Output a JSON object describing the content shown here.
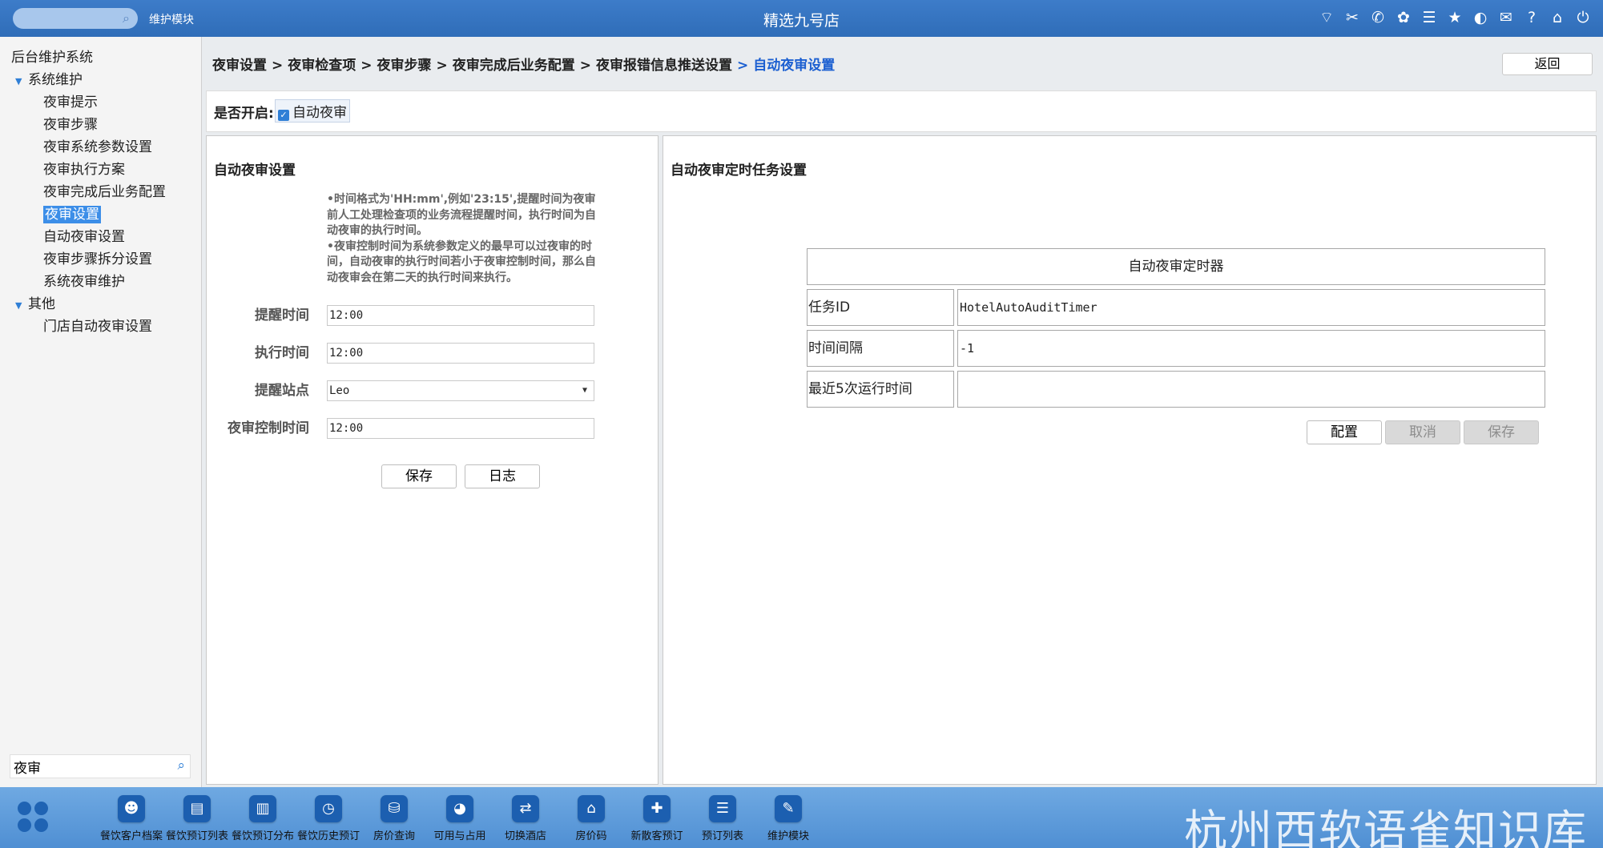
{
  "topbar": {
    "module": "维护模块",
    "title": "精选九号店",
    "icons": [
      "wifi-icon",
      "tools-icon",
      "phone-icon",
      "palette-icon",
      "menu-icon",
      "star-icon",
      "contrast-icon",
      "mail-icon",
      "help-icon",
      "home-icon",
      "power-icon"
    ]
  },
  "sidebar": {
    "root": "后台维护系统",
    "groups": [
      {
        "label": "系统维护",
        "items": [
          "夜审提示",
          "夜审步骤",
          "夜审系统参数设置",
          "夜审执行方案",
          "夜审完成后业务配置",
          "夜审设置",
          "自动夜审设置",
          "夜审步骤拆分设置",
          "系统夜审维护"
        ],
        "selected": "夜审设置"
      },
      {
        "label": "其他",
        "items": [
          "门店自动夜审设置"
        ]
      }
    ],
    "search_value": "夜审"
  },
  "breadcrumb": [
    "夜审设置",
    "夜审检查项",
    "夜审步骤",
    "夜审完成后业务配置",
    "夜审报错信息推送设置",
    "自动夜审设置"
  ],
  "back_label": "返回",
  "enable": {
    "label": "是否开启:",
    "checkbox_label": "自动夜审",
    "checked": true
  },
  "left_panel": {
    "title": "自动夜审设置",
    "notes": [
      "•时间格式为'HH:mm',例如'23:15',提醒时间为夜审前人工处理检查项的业务流程提醒时间，执行时间为自动夜审的执行时间。",
      "•夜审控制时间为系统参数定义的最早可以过夜审的时间，自动夜审的执行时间若小于夜审控制时间，那么自动夜审会在第二天的执行时间来执行。"
    ],
    "fields": [
      {
        "label": "提醒时间",
        "value": "12:00"
      },
      {
        "label": "执行时间",
        "value": "12:00"
      },
      {
        "label": "提醒站点",
        "value": "Leo",
        "dropdown": true
      },
      {
        "label": "夜审控制时间",
        "value": "12:00"
      }
    ],
    "save_label": "保存",
    "log_label": "日志"
  },
  "right_panel": {
    "title": "自动夜审定时任务设置",
    "timer_title": "自动夜审定时器",
    "rows": [
      {
        "key": "任务ID",
        "value": "HotelAutoAuditTimer"
      },
      {
        "key": "时间间隔",
        "value": "-1"
      },
      {
        "key": "最近5次运行时间",
        "value": ""
      }
    ],
    "config_label": "配置",
    "cancel_label": "取消",
    "save_label": "保存"
  },
  "bottombar": {
    "apps": [
      {
        "label": "餐饮客户档案",
        "icon": "user-icon",
        "glyph": "☻"
      },
      {
        "label": "餐饮预订列表",
        "icon": "clipboard-icon",
        "glyph": "▤"
      },
      {
        "label": "餐饮预订分布",
        "icon": "building-icon",
        "glyph": "▥"
      },
      {
        "label": "餐饮历史预订",
        "icon": "clock-icon",
        "glyph": "◷"
      },
      {
        "label": "房价查询",
        "icon": "database-icon",
        "glyph": "⛁"
      },
      {
        "label": "可用与占用",
        "icon": "pie-chart-icon",
        "glyph": "◕"
      },
      {
        "label": "切换酒店",
        "icon": "switch-icon",
        "glyph": "⇄"
      },
      {
        "label": "房价码",
        "icon": "home-icon",
        "glyph": "⌂"
      },
      {
        "label": "新散客预订",
        "icon": "user-add-icon",
        "glyph": "✚"
      },
      {
        "label": "预订列表",
        "icon": "list-icon",
        "glyph": "☰"
      },
      {
        "label": "维护模块",
        "icon": "wrench-icon",
        "glyph": "✎"
      }
    ],
    "watermark": "杭州西软语雀知识库"
  }
}
